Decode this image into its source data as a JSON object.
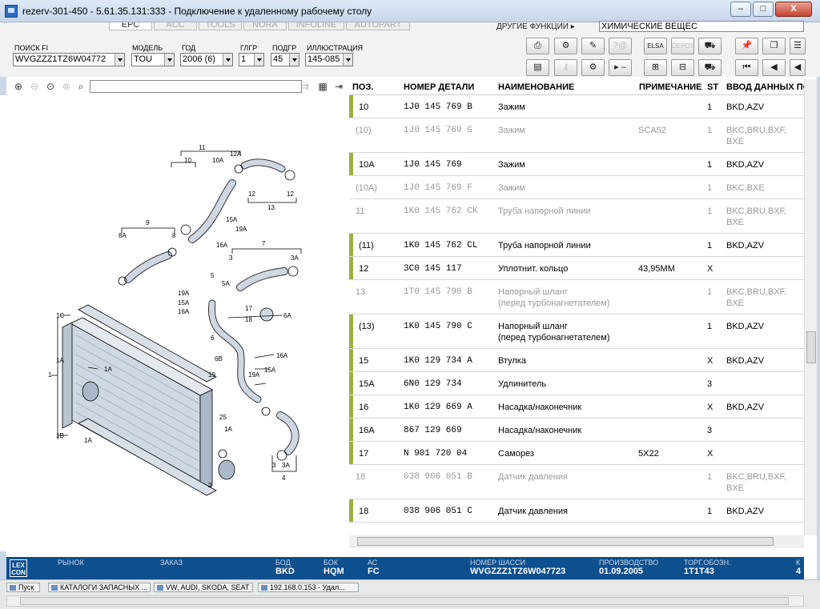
{
  "window": {
    "title": "rezerv-301-450 - 5.61.35.131:333 - Подключение к удаленному рабочему столу",
    "minimize": "–",
    "maximize": "□",
    "close": "X"
  },
  "tabs": [
    {
      "label": "EPC"
    },
    {
      "label": "ACC"
    },
    {
      "label": "TOOLS"
    },
    {
      "label": "NORA"
    },
    {
      "label": "INFOLINE"
    },
    {
      "label": "AUTOPART"
    }
  ],
  "functions": {
    "label": "ДРУГИЕ ФУНКЦИИ ▸",
    "value": "ХИМИЧЕСКИЕ ВЕЩЕС"
  },
  "filters": {
    "fi": {
      "label": "ПОИСК FI",
      "value": "WVGZZZ1TZ6W04772"
    },
    "model": {
      "label": "МОДЕЛЬ",
      "value": "TOU"
    },
    "year": {
      "label": "ГОД",
      "value": "2006 (6)"
    },
    "maingroup": {
      "label": "ГЛГР",
      "value": "1"
    },
    "subgroup": {
      "label": "ПОДГР",
      "value": "45"
    },
    "illustration": {
      "label": "ИЛЛЮСТРАЦИЯ",
      "value": "145-085"
    }
  },
  "toolbar_labels": {
    "elsa": "ELSA",
    "depot": "DEPOT",
    "minus": "▸ –"
  },
  "grid": {
    "headers": {
      "pos": "ПОЗ.",
      "part": "НОМЕР ДЕТАЛИ",
      "name": "НАИМЕНОВАНИЕ",
      "note": "ПРИМЕЧАНИЕ",
      "st": "ST",
      "data": "ВВОД ДАННЫХ ПО"
    },
    "rows": [
      {
        "pos": "10",
        "part": "1J0  145  769  B",
        "name": "Зажим",
        "name2": "",
        "note": "",
        "st": "1",
        "data": "BKD,AZV",
        "data2": "",
        "active": true
      },
      {
        "pos": "(10)",
        "part": "1J0  145  769  G",
        "name": "Зажим",
        "name2": "",
        "note": "SCA52",
        "st": "1",
        "data": "BKC,BRU,BXF,",
        "data2": "BXE",
        "active": false
      },
      {
        "pos": "10A",
        "part": "1J0  145  769",
        "name": "Зажим",
        "name2": "",
        "note": "",
        "st": "1",
        "data": "BKD,AZV",
        "data2": "",
        "active": true
      },
      {
        "pos": "(10A)",
        "part": "1J0  145  769  F",
        "name": "Зажим",
        "name2": "",
        "note": "",
        "st": "1",
        "data": "BKC,BXE",
        "data2": "",
        "active": false
      },
      {
        "pos": "11",
        "part": "1K0  145  762  CK",
        "name": "Труба напорной линии",
        "name2": "",
        "note": "",
        "st": "1",
        "data": "BKC,BRU,BXF,",
        "data2": "BXE",
        "active": false
      },
      {
        "pos": "(11)",
        "part": "1K0  145  762  CL",
        "name": "Труба напорной линии",
        "name2": "",
        "note": "",
        "st": "1",
        "data": "BKD,AZV",
        "data2": "",
        "active": true
      },
      {
        "pos": "12",
        "part": "3C0  145  117",
        "name": "Уплотнит. кольцо",
        "name2": "",
        "note": "43,95MM",
        "st": "X",
        "data": "",
        "data2": "",
        "active": true
      },
      {
        "pos": "13",
        "part": "1T0  145  790  B",
        "name": "Напорный шланг",
        "name2": "(перед турбонагнетателем)",
        "note": "",
        "st": "1",
        "data": "BKC,BRU,BXF,",
        "data2": "BXE",
        "active": false
      },
      {
        "pos": "(13)",
        "part": "1K0  145  790  C",
        "name": "Напорный шланг",
        "name2": "(перед турбонагнетателем)",
        "note": "",
        "st": "1",
        "data": "BKD,AZV",
        "data2": "",
        "active": true
      },
      {
        "pos": "15",
        "part": "1K0  129  734  A",
        "name": "Втулка",
        "name2": "",
        "note": "",
        "st": "X",
        "data": "BKD,AZV",
        "data2": "",
        "active": true
      },
      {
        "pos": "15A",
        "part": "6N0  129  734",
        "name": "Удлинитель",
        "name2": "",
        "note": "",
        "st": "3",
        "data": "",
        "data2": "",
        "active": true
      },
      {
        "pos": "16",
        "part": "1K0  129  669  A",
        "name": "Насадка/наконечник",
        "name2": "",
        "note": "",
        "st": "X",
        "data": "BKD,AZV",
        "data2": "",
        "active": true
      },
      {
        "pos": "16A",
        "part": "867  129  669",
        "name": "Насадка/наконечник",
        "name2": "",
        "note": "",
        "st": "3",
        "data": "",
        "data2": "",
        "active": true
      },
      {
        "pos": "17",
        "part": "N   901  720  04",
        "name": "Саморез",
        "name2": "",
        "note": "5X22",
        "st": "X",
        "data": "",
        "data2": "",
        "active": true
      },
      {
        "pos": "18",
        "part": "038  906  051  B",
        "name": "Датчик давления",
        "name2": "",
        "note": "",
        "st": "1",
        "data": "BKC,BRU,BXF,",
        "data2": "BXE",
        "active": false
      },
      {
        "pos": "18",
        "part": "038  906  051  C",
        "name": "Датчик давления",
        "name2": "",
        "note": "",
        "st": "1",
        "data": "BKD,AZV",
        "data2": "",
        "active": true
      }
    ]
  },
  "diagram_labels": [
    "11",
    "12A",
    "10",
    "10A",
    "12",
    "12",
    "13",
    "9",
    "8A",
    "8",
    "15A",
    "19A",
    "16A",
    "7",
    "3",
    "3A",
    "5",
    "5A",
    "19A",
    "15A",
    "16A",
    "17",
    "18",
    "6A",
    "1C",
    "1A",
    "1",
    "6",
    "6B",
    "16A",
    "19A",
    "15A",
    "19",
    "1A",
    "25",
    "1B",
    "1A",
    "3",
    "3A",
    "4",
    "2"
  ],
  "status": {
    "logo": "LEX CON",
    "market": {
      "label": "РЫНОК",
      "value": ""
    },
    "order": {
      "label": "ЗАКАЗ",
      "value": ""
    },
    "bod": {
      "label": "БОД",
      "value": "BKD"
    },
    "bok": {
      "label": "БОК",
      "value": "HQM"
    },
    "ac": {
      "label": "АС",
      "value": "FC"
    },
    "chassis": {
      "label": "НОМЕР ШАССИ",
      "value": "WVGZZZ1TZ6W047723"
    },
    "production": {
      "label": "ПРОИЗВОДСТВО",
      "value": "01.09.2005"
    },
    "trade": {
      "label": "ТОРГ.ОБОЗН.",
      "value": "1T1T43"
    },
    "extra": {
      "label": "К",
      "value": "4"
    }
  },
  "taskbar": {
    "start": "Пуск",
    "items": [
      "КАТАЛОГИ ЗАПАСНЫХ ...",
      "VW, AUDI, SKODA, SEAT ...",
      "192.168.0.153 - Удал..."
    ]
  }
}
